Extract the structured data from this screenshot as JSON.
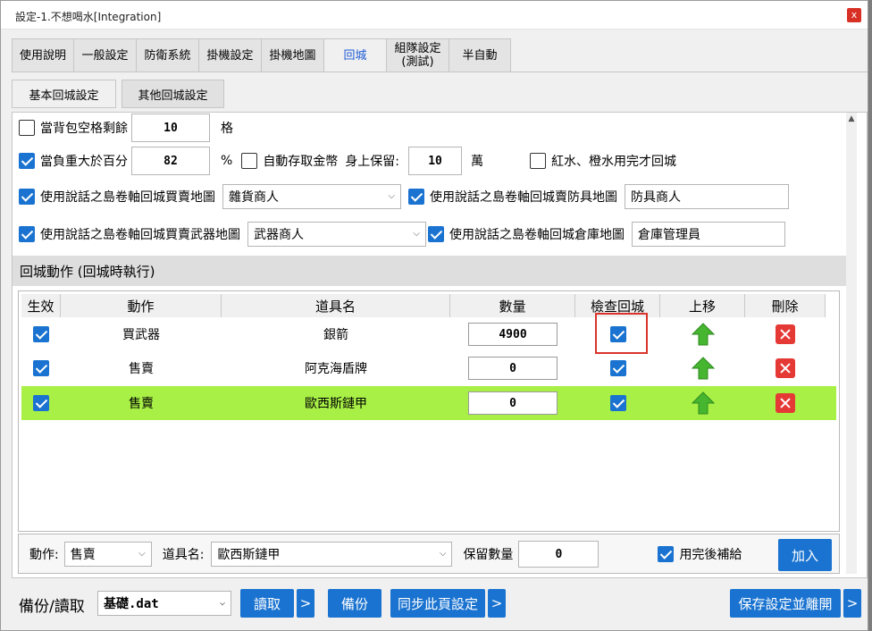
{
  "window": {
    "title": "設定-1.不想喝水[Integration]",
    "close": "x"
  },
  "tabs": [
    {
      "label": "使用說明"
    },
    {
      "label": "一般設定"
    },
    {
      "label": "防衛系統"
    },
    {
      "label": "掛機設定"
    },
    {
      "label": "掛機地圖"
    },
    {
      "label": "回城"
    },
    {
      "label": "組隊設定\n(測試)"
    },
    {
      "label": "半自動"
    }
  ],
  "subtabs": [
    {
      "label": "基本回城設定"
    },
    {
      "label": "其他回城設定"
    }
  ],
  "settings": {
    "bag": {
      "label": "當背包空格剩餘",
      "value": "10",
      "unit": "格",
      "checked": false
    },
    "weight": {
      "label": "當負重大於百分",
      "value": "82",
      "unit": "%",
      "checked": true
    },
    "auto_deposit": {
      "label": "自動存取金幣",
      "checked": false
    },
    "keep_on_hand": {
      "label": "身上保留:",
      "value": "10",
      "unit": "萬"
    },
    "potions": {
      "label": "紅水、橙水用完才回城",
      "checked": false
    },
    "scroll_sell": {
      "label": "使用說話之島卷軸回城買賣地圖",
      "value": "雜貨商人",
      "checked": true
    },
    "scroll_armor": {
      "label": "使用說話之島卷軸回城賣防具地圖",
      "value": "防具商人",
      "checked": true
    },
    "scroll_weapon": {
      "label": "使用說話之島卷軸回城買賣武器地圖",
      "value": "武器商人",
      "checked": true
    },
    "scroll_warehouse": {
      "label": "使用說話之島卷軸回城倉庫地圖",
      "value": "倉庫管理員",
      "checked": true
    }
  },
  "section": {
    "title": "回城動作 (回城時執行)"
  },
  "table": {
    "headers": [
      "生效",
      "動作",
      "道具名",
      "數量",
      "檢查回城",
      "上移",
      "刪除"
    ],
    "rows": [
      {
        "action": "買武器",
        "item": "銀箭",
        "qty": "4900"
      },
      {
        "action": "售賣",
        "item": "阿克海盾牌",
        "qty": "0"
      },
      {
        "action": "售賣",
        "item": "歐西斯鏈甲",
        "qty": "0"
      }
    ]
  },
  "editor": {
    "action_label": "動作:",
    "action_value": "售賣",
    "item_label": "道具名:",
    "item_value": "歐西斯鏈甲",
    "keep_label": "保留數量",
    "keep_value": "0",
    "refill_label": "用完後補給",
    "add_label": "加入"
  },
  "footer": {
    "backup_label": "備份/讀取",
    "file": "基礎.dat",
    "read": "讀取",
    "backup": "備份",
    "sync": "同步此頁設定",
    "save": "保存設定並離開",
    "more": ">"
  },
  "colors": {
    "accent": "#1a73d0",
    "selected_row": "#a8f046",
    "highlight": "#d9342b"
  }
}
